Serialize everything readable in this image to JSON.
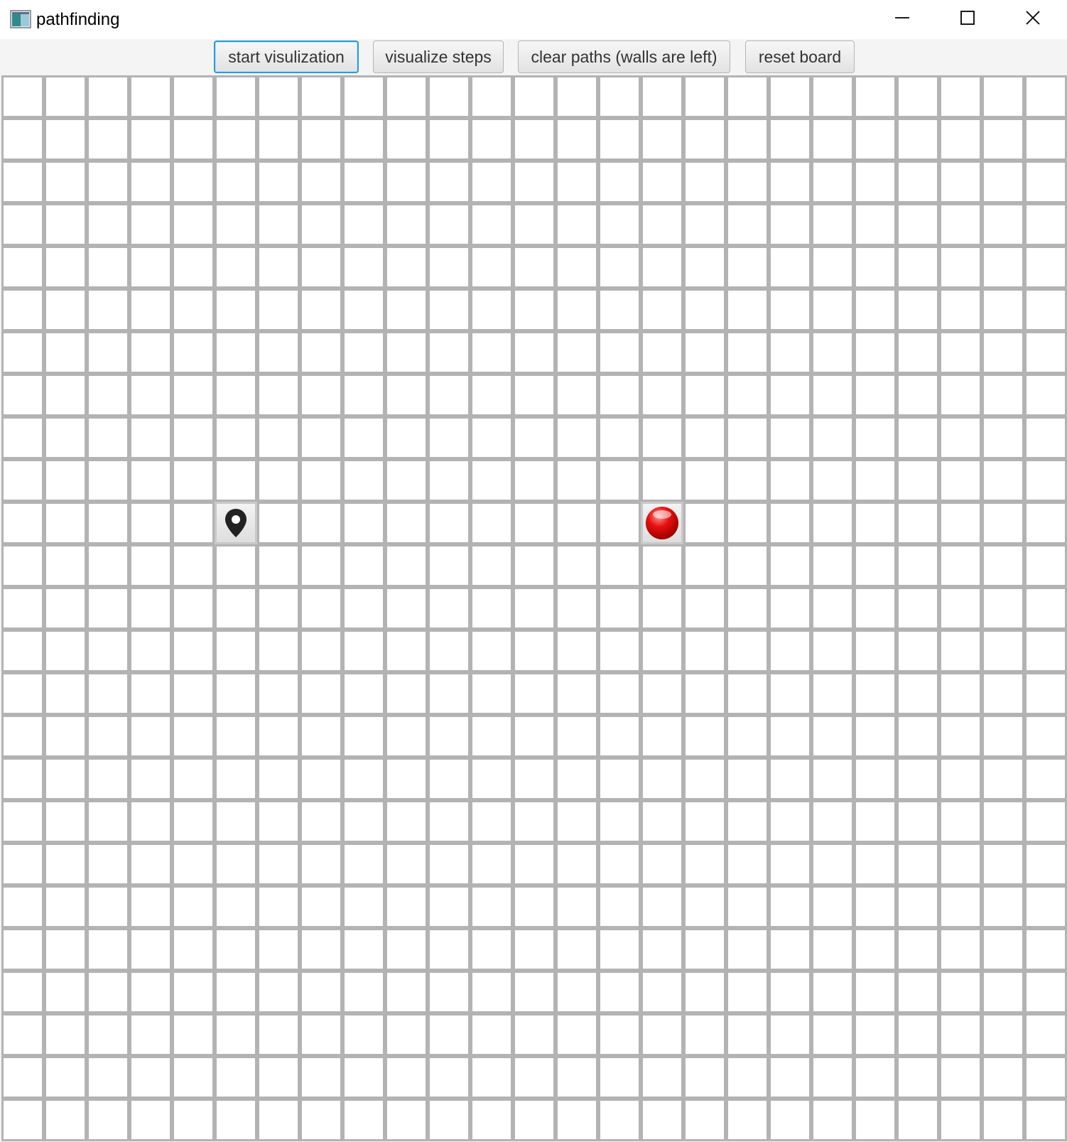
{
  "window": {
    "title": "pathfinding",
    "app_icon": "app-window-icon",
    "controls": [
      "minimize-icon",
      "maximize-icon",
      "close-icon"
    ]
  },
  "toolbar": {
    "start_label": "start visulization",
    "steps_label": "visualize steps",
    "clear_label": "clear paths (walls are left)",
    "reset_label": "reset board",
    "focused_button": "start visulization"
  },
  "grid": {
    "rows": 25,
    "columns": 25,
    "cell_state_default": "empty",
    "start": {
      "row": 10,
      "col": 5,
      "icon": "map-pin-icon"
    },
    "target": {
      "row": 10,
      "col": 15,
      "icon": "red-ball-icon"
    },
    "colors": {
      "cell_fill": "#ffffff",
      "cell_border": "#b3b3b3",
      "target": "#e81010",
      "focus_accent": "#2a9bd8"
    }
  }
}
